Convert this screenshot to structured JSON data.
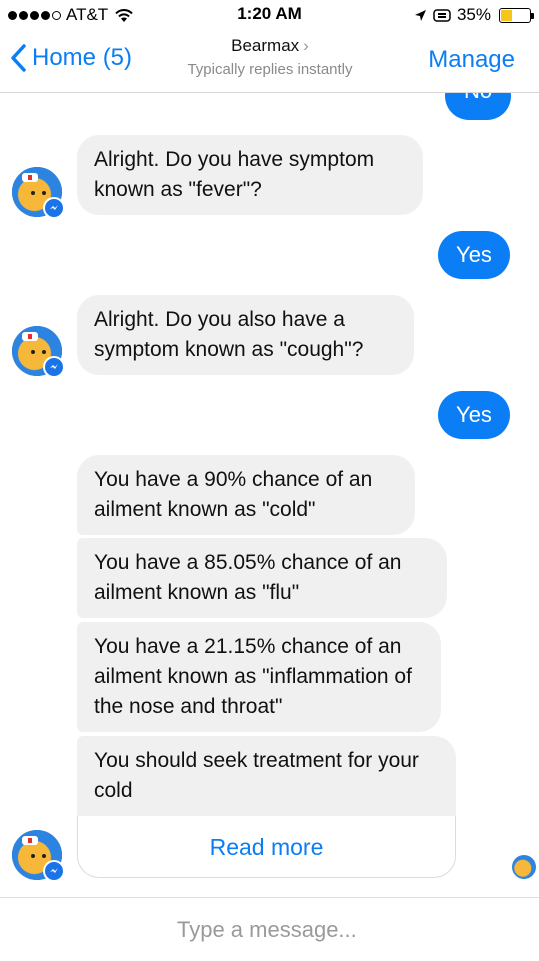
{
  "status_bar": {
    "carrier": "AT&T",
    "time": "1:20 AM",
    "battery": "35%",
    "battery_level": 0.35,
    "icons": [
      "signal-dots",
      "wifi-icon",
      "location-arrow-icon",
      "alarm-icon",
      "battery-icon"
    ]
  },
  "nav": {
    "back_label": "Home (5)",
    "title": "Bearmax",
    "subtitle": "Typically replies instantly",
    "manage_label": "Manage"
  },
  "messages": {
    "out_no": "No",
    "in_fever": "Alright. Do you have symptom known as \"fever\"?",
    "out_yes_1": "Yes",
    "in_cough": "Alright. Do you also have a symptom known as \"cough\"?",
    "out_yes_2": "Yes",
    "in_cold": "You have a 90% chance of an ailment known as \"cold\"",
    "in_flu": "You have a 85.05% chance of an ailment known as \"flu\"",
    "in_inflammation": "You have a 21.15% chance of an ailment known as \"inflammation of the nose and throat\"",
    "in_treatment": "You should seek treatment for your cold",
    "read_more": "Read more"
  },
  "composer": {
    "placeholder": "Type a message..."
  },
  "colors": {
    "accent": "#0b7ef5",
    "incoming_bubble": "#f1f0f0",
    "battery_fill": "#f5c518"
  }
}
